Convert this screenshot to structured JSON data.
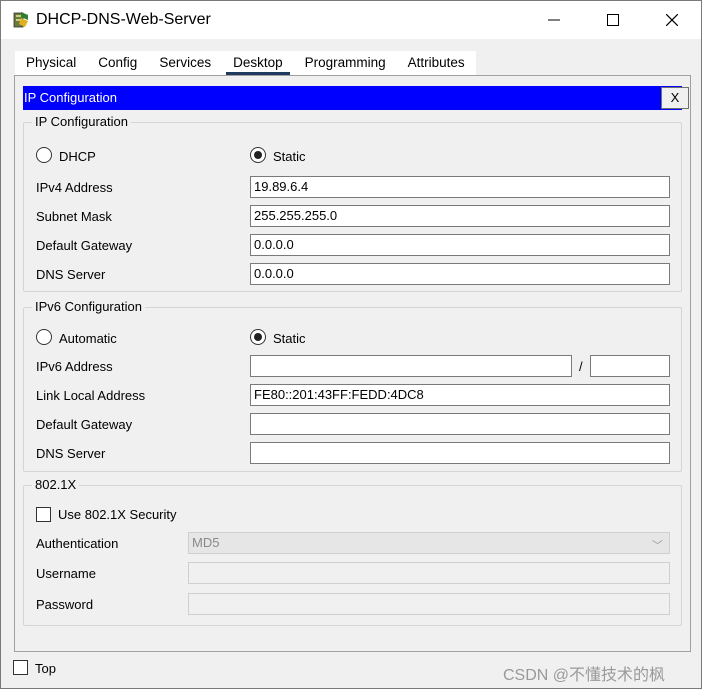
{
  "window": {
    "title": "DHCP-DNS-Web-Server",
    "minimize": "—",
    "maximize": "☐",
    "close": "✕"
  },
  "tabs": [
    {
      "label": "Physical"
    },
    {
      "label": "Config"
    },
    {
      "label": "Services"
    },
    {
      "label": "Desktop"
    },
    {
      "label": "Programming"
    },
    {
      "label": "Attributes"
    }
  ],
  "active_tab": "Desktop",
  "panel": {
    "title": "IP Configuration",
    "close_label": "X"
  },
  "ipv4": {
    "legend": "IP Configuration",
    "dhcp_label": "DHCP",
    "static_label": "Static",
    "selected": "Static",
    "ipv4_address_label": "IPv4 Address",
    "ipv4_address": "19.89.6.4",
    "subnet_mask_label": "Subnet Mask",
    "subnet_mask": "255.255.255.0",
    "default_gateway_label": "Default Gateway",
    "default_gateway": "0.0.0.0",
    "dns_server_label": "DNS Server",
    "dns_server": "0.0.0.0"
  },
  "ipv6": {
    "legend": "IPv6 Configuration",
    "automatic_label": "Automatic",
    "static_label": "Static",
    "selected": "Static",
    "ipv6_address_label": "IPv6 Address",
    "ipv6_address": "",
    "prefix_separator": "/",
    "prefix_length": "",
    "link_local_label": "Link Local Address",
    "link_local_address": "FE80::201:43FF:FEDD:4DC8",
    "default_gateway_label": "Default Gateway",
    "default_gateway": "",
    "dns_server_label": "DNS Server",
    "dns_server": ""
  },
  "dot1x": {
    "legend": "802.1X",
    "use_security_label": "Use 802.1X Security",
    "use_security_checked": false,
    "authentication_label": "Authentication",
    "authentication_value": "MD5",
    "username_label": "Username",
    "username": "",
    "password_label": "Password",
    "password": ""
  },
  "footer": {
    "top_label": "Top",
    "top_checked": false
  },
  "watermark": "CSDN @不懂技术的枫"
}
